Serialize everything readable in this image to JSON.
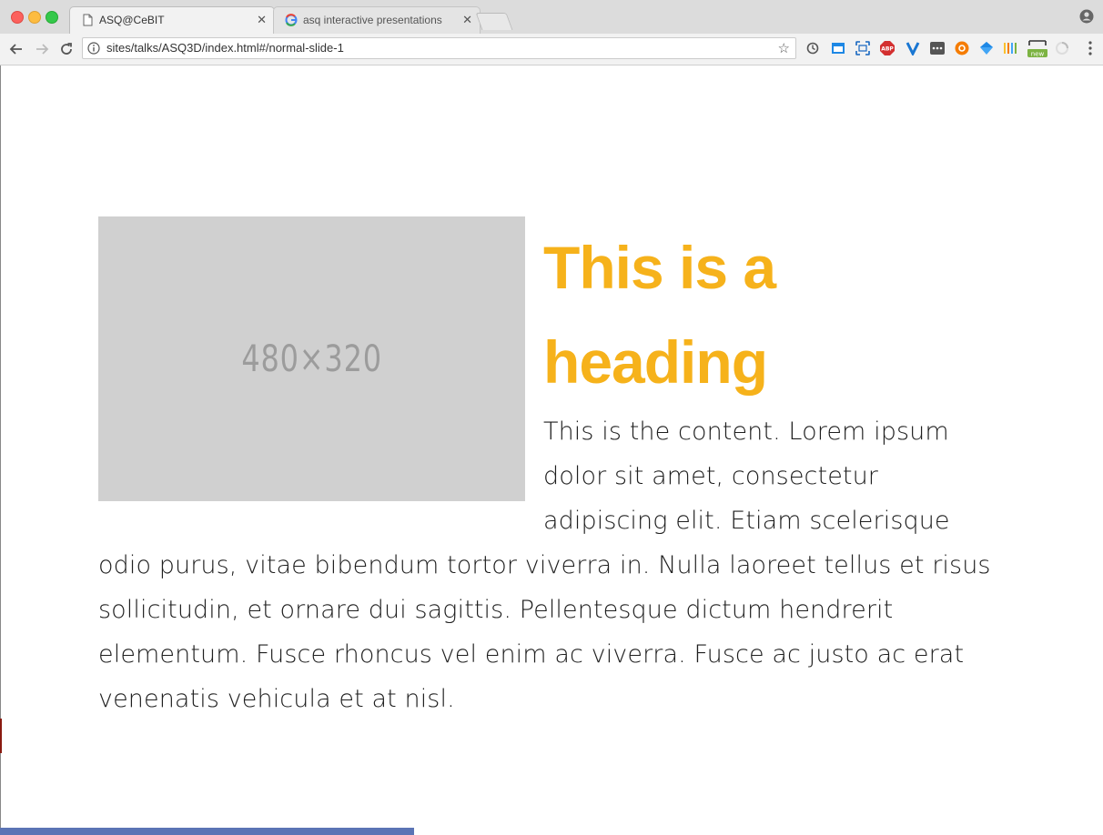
{
  "browser": {
    "tabs": [
      {
        "title": "ASQ@CeBIT",
        "active": true,
        "icon": "page-icon"
      },
      {
        "title": "asq interactive presentations",
        "active": false,
        "icon": "google-icon"
      }
    ],
    "url": "sites/talks/ASQ3D/index.html#/normal-slide-1",
    "extensions": [
      "sync-icon",
      "tab-icon",
      "screenshot-icon",
      "adblock-plus-icon",
      "vimium-icon",
      "dots-icon",
      "orange-extension-icon",
      "diamond-icon",
      "bars-icon",
      "new-extension-icon",
      "spinner-icon"
    ],
    "extension_badges": {
      "adblock": "ABP",
      "new": "new"
    }
  },
  "slide": {
    "placeholder_label": "480×320",
    "heading": "This is a heading",
    "content": "This is the content. Lorem ipsum dolor sit amet, consectetur adipiscing elit. Etiam scelerisque odio purus, vitae bibendum tortor viverra in. Nulla laoreet tellus et risus sollicitudin, et ornare dui sagittis. Pellentesque dictum hendrerit elementum. Fusce rhoncus vel enim ac viverra. Fusce ac justo ac erat venenatis vehicula et at nisl."
  },
  "colors": {
    "heading": "#f6b21b",
    "progress": "#5b74b5",
    "placeholder": "#d0d0d0"
  },
  "progress": {
    "fraction": 0.375
  }
}
